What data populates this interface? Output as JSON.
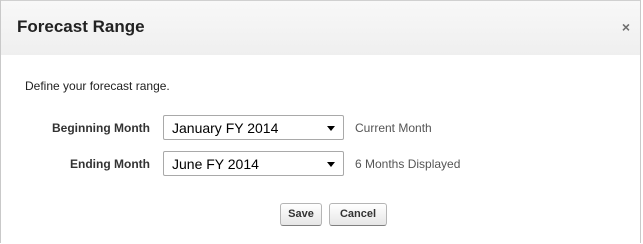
{
  "dialog": {
    "title": "Forecast Range",
    "close_label": "×",
    "intro": "Define your forecast range."
  },
  "fields": {
    "beginning": {
      "label": "Beginning Month",
      "value": "January FY 2014",
      "hint": "Current Month"
    },
    "ending": {
      "label": "Ending Month",
      "value": "June FY 2014",
      "hint": "6 Months Displayed"
    }
  },
  "buttons": {
    "save": "Save",
    "cancel": "Cancel"
  }
}
